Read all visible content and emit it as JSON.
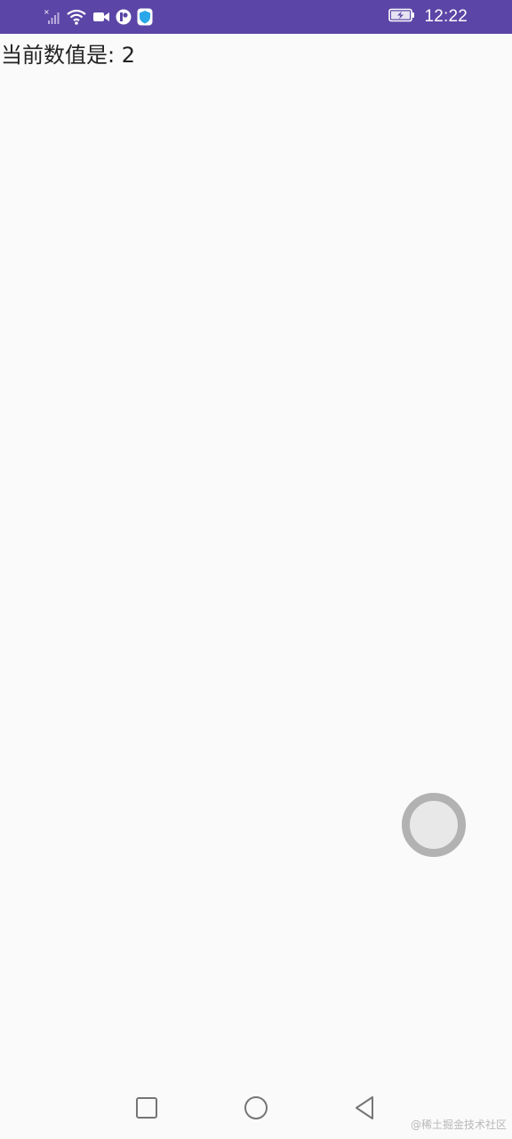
{
  "status_bar": {
    "time": "12:22",
    "background": "#5b45a6",
    "icons": [
      "signal-off-icon",
      "wifi-icon",
      "video-camera-icon",
      "app-notification-icon",
      "shield-icon",
      "battery-charging-icon"
    ]
  },
  "main": {
    "counter_text": "当前数值是: 2"
  },
  "touch_indicator": {
    "icon": "touch-indicator-icon"
  },
  "nav_bar": {
    "buttons": [
      "recent-apps-icon",
      "home-icon",
      "back-icon"
    ]
  },
  "watermark": {
    "text": "@稀土掘金技术社区"
  }
}
